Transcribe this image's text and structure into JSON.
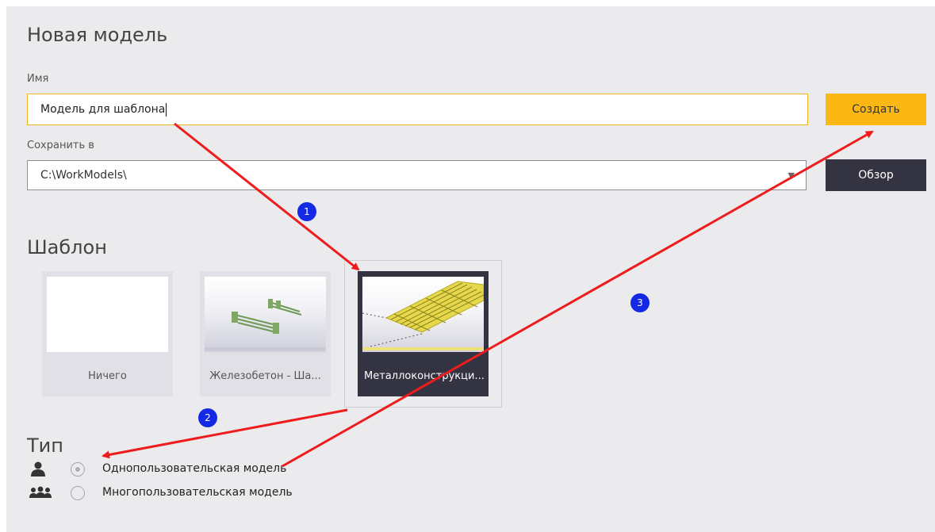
{
  "page": {
    "title": "Новая модель"
  },
  "name_field": {
    "label": "Имя",
    "value": "Модель для шаблона"
  },
  "save_field": {
    "label": "Сохранить в",
    "value": "C:\\WorkModels\\"
  },
  "buttons": {
    "create": "Создать",
    "browse": "Обзор"
  },
  "template_section": {
    "title": "Шаблон",
    "items": [
      {
        "label": "Ничего",
        "selected": false
      },
      {
        "label": "Железобетон - Ша...",
        "selected": false
      },
      {
        "label": "Металлоконструкци...",
        "selected": true
      }
    ]
  },
  "type_section": {
    "title": "Тип",
    "options": [
      {
        "label": "Однопользовательская модель",
        "icon": "single-user-icon",
        "selected": true
      },
      {
        "label": "Многопользовательская модель",
        "icon": "multi-user-icon",
        "selected": false
      }
    ]
  },
  "annotations": {
    "badges": [
      "1",
      "2",
      "3"
    ],
    "arrow_color": "#ee1c1c"
  },
  "colors": {
    "accent": "#fbb814",
    "dark": "#333342",
    "background": "#ebeaed"
  }
}
